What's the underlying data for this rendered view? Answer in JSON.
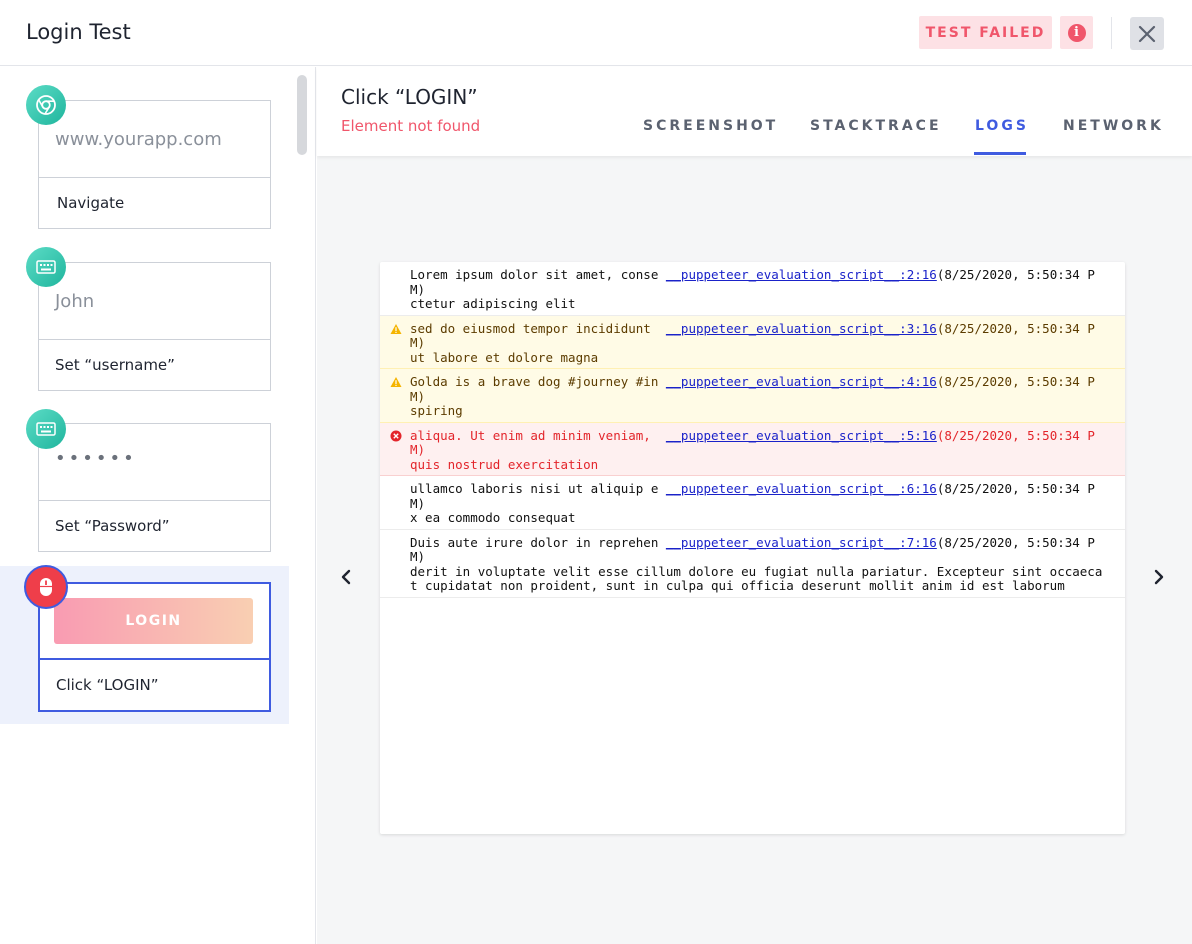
{
  "header": {
    "title": "Login Test",
    "status": "TEST FAILED",
    "info_glyph": "i"
  },
  "steps": [
    {
      "field": "www.yourapp.com",
      "label": "Navigate",
      "icon": "chrome-icon"
    },
    {
      "field": "John",
      "label": "Set “username”",
      "icon": "keyboard-icon"
    },
    {
      "field": "••••••",
      "label": "Set “Password”",
      "icon": "keyboard-icon"
    },
    {
      "field": "LOGIN",
      "label": "Click “LOGIN”",
      "icon": "mouse-icon"
    }
  ],
  "detail": {
    "title": "Click “LOGIN”",
    "error": "Element not found",
    "tabs": [
      "SCREENSHOT",
      "STACKTRACE",
      "LOGS",
      "NETWORK"
    ],
    "active_tab": "LOGS"
  },
  "logs": [
    {
      "level": "info",
      "lead": "Lorem ipsum dolor sit amet, conse ",
      "source": "__puppeteer_evaluation_script__:2:16",
      "time": "(8/25/2020, 5:50:34 PM)",
      "rest": "ctetur adipiscing elit"
    },
    {
      "level": "warn",
      "lead": "sed do eiusmod tempor incididunt  ",
      "source": "__puppeteer_evaluation_script__:3:16",
      "time": "(8/25/2020, 5:50:34 PM)",
      "rest": "ut labore et dolore magna"
    },
    {
      "level": "warn",
      "lead": "Golda is a brave dog #journey #in ",
      "source": "__puppeteer_evaluation_script__:4:16",
      "time": "(8/25/2020, 5:50:34 PM)",
      "rest": "spiring"
    },
    {
      "level": "error",
      "lead": "aliqua. Ut enim ad minim veniam,  ",
      "source": "__puppeteer_evaluation_script__:5:16",
      "time": "(8/25/2020, 5:50:34 PM)",
      "rest": "quis nostrud exercitation"
    },
    {
      "level": "info",
      "lead": "ullamco laboris nisi ut aliquip e ",
      "source": "__puppeteer_evaluation_script__:6:16",
      "time": "(8/25/2020, 5:50:34 PM)",
      "rest": "x ea commodo consequat"
    },
    {
      "level": "info",
      "lead": "Duis aute irure dolor in reprehen ",
      "source": "__puppeteer_evaluation_script__:7:16",
      "time": "(8/25/2020, 5:50:34 PM)",
      "rest": "derit in voluptate velit esse cillum dolore eu fugiat nulla pariatur. Excepteur sint occaecat cupidatat non proident, sunt in culpa qui officia deserunt mollit anim id est laborum"
    }
  ],
  "colors": {
    "accent": "#3f5be0",
    "error": "#f0566b",
    "teal": "#1fb59d"
  }
}
